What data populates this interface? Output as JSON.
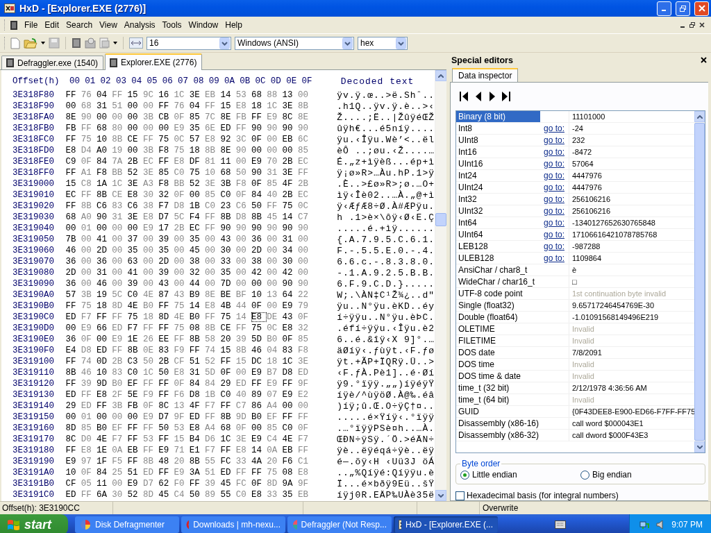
{
  "window": {
    "title": "HxD - [Explorer.EXE (2776)]"
  },
  "menu": [
    "File",
    "Edit",
    "Search",
    "View",
    "Analysis",
    "Tools",
    "Window",
    "Help"
  ],
  "toolbar": {
    "bytes_per_row": "16",
    "charset": "Windows (ANSI)",
    "offset_base": "hex"
  },
  "document_tabs": [
    {
      "label": "Defraggler.exe (1540)",
      "selected": false
    },
    {
      "label": "Explorer.EXE (2776)",
      "selected": true
    }
  ],
  "hex": {
    "offset_header": "Offset(h)",
    "columns": [
      "00",
      "01",
      "02",
      "03",
      "04",
      "05",
      "06",
      "07",
      "08",
      "09",
      "0A",
      "0B",
      "0C",
      "0D",
      "0E",
      "0F"
    ],
    "text_header": "Decoded text",
    "rows": [
      {
        "offset": "3E318F80",
        "bytes": [
          "FF",
          "76",
          "04",
          "FF",
          "15",
          "9C",
          "16",
          "1C",
          "3E",
          "EB",
          "14",
          "53",
          "68",
          "88",
          "13",
          "00"
        ],
        "text": "ÿv.ÿ.œ..>ë.Shˆ.."
      },
      {
        "offset": "3E318F90",
        "bytes": [
          "00",
          "68",
          "31",
          "51",
          "00",
          "00",
          "FF",
          "76",
          "04",
          "FF",
          "15",
          "E8",
          "18",
          "1C",
          "3E",
          "8B"
        ],
        "text": ".h1Q..ÿv.ÿ.è..>‹"
      },
      {
        "offset": "3E318FA0",
        "bytes": [
          "8E",
          "90",
          "00",
          "00",
          "00",
          "3B",
          "CB",
          "0F",
          "85",
          "7C",
          "8E",
          "FB",
          "FF",
          "E9",
          "8C",
          "8E"
        ],
        "text": "Ž....;Ë..|ŽûÿéŒŽ"
      },
      {
        "offset": "3E318FB0",
        "bytes": [
          "FB",
          "FF",
          "68",
          "80",
          "00",
          "00",
          "00",
          "E9",
          "35",
          "6E",
          "ED",
          "FF",
          "90",
          "90",
          "90",
          "90"
        ],
        "text": "ûÿh€...é5níÿ...."
      },
      {
        "offset": "3E318FC0",
        "bytes": [
          "FF",
          "75",
          "10",
          "8B",
          "CE",
          "FF",
          "75",
          "0C",
          "57",
          "E8",
          "92",
          "3C",
          "0F",
          "00",
          "EB",
          "6C"
        ],
        "text": "ÿu.‹Îÿu.Wè’<..ël"
      },
      {
        "offset": "3E318FD0",
        "bytes": [
          "E8",
          "D4",
          "A0",
          "19",
          "00",
          "3B",
          "F8",
          "75",
          "18",
          "8B",
          "8E",
          "90",
          "00",
          "00",
          "00",
          "85"
        ],
        "text": "èÔ ..;øu.‹Ž....…"
      },
      {
        "offset": "3E318FE0",
        "bytes": [
          "C9",
          "0F",
          "84",
          "7A",
          "2B",
          "EC",
          "FF",
          "E8",
          "DF",
          "81",
          "11",
          "00",
          "E9",
          "70",
          "2B",
          "EC"
        ],
        "text": "É.„z+ìÿèß...ép+ì"
      },
      {
        "offset": "3E318FF0",
        "bytes": [
          "FF",
          "A1",
          "F8",
          "BB",
          "52",
          "3E",
          "85",
          "C0",
          "75",
          "10",
          "68",
          "50",
          "90",
          "31",
          "3E",
          "FF"
        ],
        "text": "ÿ¡ø»R>…Àu.hP.1>ÿ"
      },
      {
        "offset": "3E319000",
        "bytes": [
          "15",
          "C8",
          "1A",
          "1C",
          "3E",
          "A3",
          "F8",
          "BB",
          "52",
          "3E",
          "3B",
          "F8",
          "0F",
          "85",
          "4F",
          "2B"
        ],
        "text": ".È..>£ø»R>;ø.…O+"
      },
      {
        "offset": "3E319010",
        "bytes": [
          "EC",
          "FF",
          "8B",
          "CE",
          "E8",
          "30",
          "32",
          "0F",
          "00",
          "85",
          "C0",
          "0F",
          "84",
          "40",
          "2B",
          "EC"
        ],
        "text": "ìÿ‹Îè02..…À.„@+ì"
      },
      {
        "offset": "3E319020",
        "bytes": [
          "FF",
          "8B",
          "C6",
          "83",
          "C6",
          "38",
          "F7",
          "D8",
          "1B",
          "C0",
          "23",
          "C6",
          "50",
          "FF",
          "75",
          "0C"
        ],
        "text": "ÿ‹ÆƒÆ8÷Ø.À#ÆPÿu."
      },
      {
        "offset": "3E319030",
        "bytes": [
          "68",
          "A0",
          "90",
          "31",
          "3E",
          "E8",
          "D7",
          "5C",
          "F4",
          "FF",
          "8B",
          "D8",
          "8B",
          "45",
          "14",
          "C7"
        ],
        "text": "h .1>è×\\ôÿ‹Ø‹E.Ç"
      },
      {
        "offset": "3E319040",
        "bytes": [
          "00",
          "01",
          "00",
          "00",
          "00",
          "E9",
          "17",
          "2B",
          "EC",
          "FF",
          "90",
          "90",
          "90",
          "90",
          "90",
          "90"
        ],
        "text": ".....é.+ìÿ......"
      },
      {
        "offset": "3E319050",
        "bytes": [
          "7B",
          "00",
          "41",
          "00",
          "37",
          "00",
          "39",
          "00",
          "35",
          "00",
          "43",
          "00",
          "36",
          "00",
          "31",
          "00"
        ],
        "text": "{.A.7.9.5.C.6.1."
      },
      {
        "offset": "3E319060",
        "bytes": [
          "46",
          "00",
          "2D",
          "00",
          "35",
          "00",
          "35",
          "00",
          "45",
          "00",
          "30",
          "00",
          "2D",
          "00",
          "34",
          "00"
        ],
        "text": "F.-.5.5.E.0.-.4."
      },
      {
        "offset": "3E319070",
        "bytes": [
          "36",
          "00",
          "36",
          "00",
          "63",
          "00",
          "2D",
          "00",
          "38",
          "00",
          "33",
          "00",
          "38",
          "00",
          "30",
          "00"
        ],
        "text": "6.6.c.-.8.3.8.0."
      },
      {
        "offset": "3E319080",
        "bytes": [
          "2D",
          "00",
          "31",
          "00",
          "41",
          "00",
          "39",
          "00",
          "32",
          "00",
          "35",
          "00",
          "42",
          "00",
          "42",
          "00"
        ],
        "text": "-.1.A.9.2.5.B.B."
      },
      {
        "offset": "3E319090",
        "bytes": [
          "36",
          "00",
          "46",
          "00",
          "39",
          "00",
          "43",
          "00",
          "44",
          "00",
          "7D",
          "00",
          "00",
          "00",
          "90",
          "90"
        ],
        "text": "6.F.9.C.D.}....."
      },
      {
        "offset": "3E3190A0",
        "bytes": [
          "57",
          "3B",
          "19",
          "5C",
          "C0",
          "4E",
          "87",
          "43",
          "B9",
          "8E",
          "BE",
          "BF",
          "10",
          "13",
          "64",
          "22"
        ],
        "text": "W;.\\ÀN‡C¹Ž¾¿..d\""
      },
      {
        "offset": "3E3190B0",
        "bytes": [
          "FF",
          "75",
          "18",
          "8D",
          "4E",
          "B0",
          "FF",
          "75",
          "14",
          "E8",
          "4B",
          "44",
          "0F",
          "00",
          "E9",
          "79"
        ],
        "text": "ÿu..N°ÿu.èKD..éy"
      },
      {
        "offset": "3E3190C0",
        "bytes": [
          "ED",
          "F7",
          "FF",
          "FF",
          "75",
          "18",
          "8D",
          "4E",
          "B0",
          "FF",
          "75",
          "14",
          {
            "value": "E8",
            "cursor": true
          },
          "DE",
          "43",
          "0F"
        ],
        "text": "í÷ÿÿu..N°ÿu.èÞC."
      },
      {
        "offset": "3E3190D0",
        "bytes": [
          "00",
          "E9",
          "66",
          "ED",
          "F7",
          "FF",
          "FF",
          "75",
          "08",
          "8B",
          "CE",
          "FF",
          "75",
          "0C",
          "E8",
          "32"
        ],
        "text": ".éfí÷ÿÿu.‹Îÿu.è2"
      },
      {
        "offset": "3E3190E0",
        "bytes": [
          "36",
          "0F",
          "00",
          "E9",
          "1E",
          "26",
          "EE",
          "FF",
          "8B",
          "58",
          "20",
          "39",
          "5D",
          "B0",
          "0F",
          "85"
        ],
        "text": "6..é.&îÿ‹X 9]°.…"
      },
      {
        "offset": "3E3190F0",
        "bytes": [
          "E4",
          "D8",
          "ED",
          "FF",
          "8B",
          "0E",
          "83",
          "F9",
          "FF",
          "74",
          "15",
          "8B",
          "46",
          "04",
          "83",
          "F8"
        ],
        "text": "äØíÿ‹.ƒùÿt.‹F.ƒø"
      },
      {
        "offset": "3E319100",
        "bytes": [
          "FF",
          "74",
          "0D",
          "2B",
          "C3",
          "50",
          "2B",
          "CF",
          "51",
          "52",
          "FF",
          "15",
          "DC",
          "18",
          "1C",
          "3E"
        ],
        "text": "ÿt.+ÃP+ÏQRÿ.Ü..>"
      },
      {
        "offset": "3E319110",
        "bytes": [
          "8B",
          "46",
          "10",
          "83",
          "C0",
          "1C",
          "50",
          "E8",
          "31",
          "5D",
          "0F",
          "00",
          "E9",
          "B7",
          "D8",
          "ED"
        ],
        "text": "‹F.ƒÀ.Pè1]..é·Øí"
      },
      {
        "offset": "3E319120",
        "bytes": [
          "FF",
          "39",
          "9D",
          "B0",
          "EF",
          "FF",
          "FF",
          "0F",
          "84",
          "84",
          "29",
          "ED",
          "FF",
          "E9",
          "FF",
          "9F"
        ],
        "text": "ÿ9.°ïÿÿ.„„)íÿéÿŸ"
      },
      {
        "offset": "3E319130",
        "bytes": [
          "ED",
          "FF",
          "E8",
          "2F",
          "5E",
          "F9",
          "FF",
          "F6",
          "D8",
          "1B",
          "C0",
          "40",
          "89",
          "07",
          "E9",
          "E2"
        ],
        "text": "íÿè/^ùÿöØ.À@‰.éâ"
      },
      {
        "offset": "3E319140",
        "bytes": [
          "29",
          "ED",
          "FF",
          "3B",
          "FB",
          "0F",
          "8C",
          "13",
          "4F",
          "F7",
          "FF",
          "C7",
          "86",
          "A4",
          "00",
          "00"
        ],
        "text": ")íÿ;û.Œ.O÷ÿÇ†¤.."
      },
      {
        "offset": "3E319150",
        "bytes": [
          "00",
          "01",
          "00",
          "00",
          "00",
          "E9",
          "D7",
          "9F",
          "ED",
          "FF",
          "8B",
          "9D",
          "B0",
          "EF",
          "FF",
          "FF"
        ],
        "text": ".....é×Ÿíÿ‹.°ïÿÿ"
      },
      {
        "offset": "3E319160",
        "bytes": [
          "8D",
          "85",
          "B0",
          "EF",
          "FF",
          "FF",
          "50",
          "53",
          "E8",
          "A4",
          "68",
          "0F",
          "00",
          "85",
          "C0",
          "0F"
        ],
        "text": ".…°ïÿÿPSè¤h..…À."
      },
      {
        "offset": "3E319170",
        "bytes": [
          "8C",
          "D0",
          "4E",
          "F7",
          "FF",
          "53",
          "FF",
          "15",
          "B4",
          "D6",
          "1C",
          "3E",
          "E9",
          "C4",
          "4E",
          "F7"
        ],
        "text": "ŒÐN÷ÿSÿ.´Ö.>éÄN÷"
      },
      {
        "offset": "3E319180",
        "bytes": [
          "FF",
          "E8",
          "1E",
          "0A",
          "EB",
          "FF",
          "E9",
          "71",
          "E1",
          "F7",
          "FF",
          "E8",
          "14",
          "0A",
          "EB",
          "FF"
        ],
        "text": "ÿè..ëÿéqá÷ÿè..ëÿ"
      },
      {
        "offset": "3E319190",
        "bytes": [
          "E9",
          "97",
          "1F",
          "F5",
          "FF",
          "8B",
          "48",
          "20",
          "8B",
          "55",
          "FC",
          "33",
          "4A",
          "20",
          "F6",
          "C1"
        ],
        "text": "é—.õÿ‹H ‹Uü3J öÁ"
      },
      {
        "offset": "3E3191A0",
        "bytes": [
          "10",
          "0F",
          "84",
          "25",
          "51",
          "ED",
          "FF",
          "E9",
          "3A",
          "51",
          "ED",
          "FF",
          "FF",
          "75",
          "08",
          "E8"
        ],
        "text": "..„%Qíÿé:Qíÿÿu.è"
      },
      {
        "offset": "3E3191B0",
        "bytes": [
          "CF",
          "05",
          "11",
          "00",
          "E9",
          "D7",
          "62",
          "F0",
          "FF",
          "39",
          "45",
          "FC",
          "0F",
          "8D",
          "9A",
          "9F"
        ],
        "text": "Ï...é×bðÿ9Eü..šŸ"
      },
      {
        "offset": "3E3191C0",
        "bytes": [
          "ED",
          "FF",
          "6A",
          "30",
          "52",
          "8D",
          "45",
          "C4",
          "50",
          "89",
          "55",
          "C0",
          "E8",
          "33",
          "35",
          "EB"
        ],
        "text": "íÿj0R.EÄP‰UÀè35ë"
      }
    ]
  },
  "special_editors": {
    "title": "Special editors",
    "tab": "Data inspector",
    "rows": [
      {
        "label": "Binary (8 bit)",
        "value": "11101000",
        "selected": true,
        "disabled": false
      },
      {
        "label": "Int8",
        "goto": "go to:",
        "value": "-24",
        "selected": false,
        "disabled": false
      },
      {
        "label": "UInt8",
        "goto": "go to:",
        "value": "232",
        "selected": false,
        "disabled": false
      },
      {
        "label": "Int16",
        "goto": "go to:",
        "value": "-8472",
        "selected": false,
        "disabled": false
      },
      {
        "label": "UInt16",
        "goto": "go to:",
        "value": "57064",
        "selected": false,
        "disabled": false
      },
      {
        "label": "Int24",
        "goto": "go to:",
        "value": "4447976",
        "selected": false,
        "disabled": false
      },
      {
        "label": "UInt24",
        "goto": "go to:",
        "value": "4447976",
        "selected": false,
        "disabled": false
      },
      {
        "label": "Int32",
        "goto": "go to:",
        "value": "256106216",
        "selected": false,
        "disabled": false
      },
      {
        "label": "UInt32",
        "goto": "go to:",
        "value": "256106216",
        "selected": false,
        "disabled": false
      },
      {
        "label": "Int64",
        "goto": "go to:",
        "value": "-1340127652630765848",
        "selected": false,
        "disabled": false
      },
      {
        "label": "UInt64",
        "goto": "go to:",
        "value": "17106616421078785768",
        "selected": false,
        "disabled": false
      },
      {
        "label": "LEB128",
        "goto": "go to:",
        "value": "-987288",
        "selected": false,
        "disabled": false
      },
      {
        "label": "ULEB128",
        "goto": "go to:",
        "value": "1109864",
        "selected": false,
        "disabled": false
      },
      {
        "label": "AnsiChar / char8_t",
        "value": "è",
        "selected": false,
        "disabled": false
      },
      {
        "label": "WideChar / char16_t",
        "value": "□",
        "selected": false,
        "disabled": false
      },
      {
        "label": "UTF-8 code point",
        "value": "1st continuation byte invalid",
        "selected": false,
        "disabled": true
      },
      {
        "label": "Single (float32)",
        "value": "9.65717246454769E-30",
        "selected": false,
        "disabled": false
      },
      {
        "label": "Double (float64)",
        "value": "-1.01091568149496E219",
        "selected": false,
        "disabled": false
      },
      {
        "label": "OLETIME",
        "value": "Invalid",
        "selected": false,
        "disabled": true
      },
      {
        "label": "FILETIME",
        "value": "Invalid",
        "selected": false,
        "disabled": true
      },
      {
        "label": "DOS date",
        "value": "7/8/2091",
        "selected": false,
        "disabled": false
      },
      {
        "label": "DOS time",
        "value": "Invalid",
        "selected": false,
        "disabled": true
      },
      {
        "label": "DOS time & date",
        "value": "Invalid",
        "selected": false,
        "disabled": true
      },
      {
        "label": "time_t (32 bit)",
        "value": "2/12/1978 4:36:56 AM",
        "selected": false,
        "disabled": false
      },
      {
        "label": "time_t (64 bit)",
        "value": "Invalid",
        "selected": false,
        "disabled": true
      },
      {
        "label": "GUID",
        "value": "{0F43DEE8-E900-ED66-F7FF-FF75",
        "selected": false,
        "disabled": false
      },
      {
        "label": "Disassembly (x86-16)",
        "value": "call word $000043E1",
        "selected": false,
        "disabled": false
      },
      {
        "label": "Disassembly (x86-32)",
        "value": "call dword $000F43E3",
        "selected": false,
        "disabled": false
      }
    ],
    "byte_order": {
      "title": "Byte order",
      "options": [
        {
          "label": "Little endian",
          "selected": true
        },
        {
          "label": "Big endian",
          "selected": false
        }
      ]
    },
    "hex_basis": {
      "label": "Hexadecimal basis (for integral numbers)",
      "checked": false
    }
  },
  "status_bar": {
    "offset": "Offset(h): 3E3190CC",
    "mode": "Overwrite"
  },
  "taskbar": {
    "start": "start",
    "tasks": [
      {
        "label": "Disk Defragmenter",
        "selected": false
      },
      {
        "label": "Downloads | mh-nexu...",
        "selected": false
      },
      {
        "label": "Defraggler (Not Resp...",
        "selected": false
      },
      {
        "label": "HxD - [Explorer.EXE (...",
        "selected": true
      }
    ],
    "clock": "9:07 PM"
  }
}
